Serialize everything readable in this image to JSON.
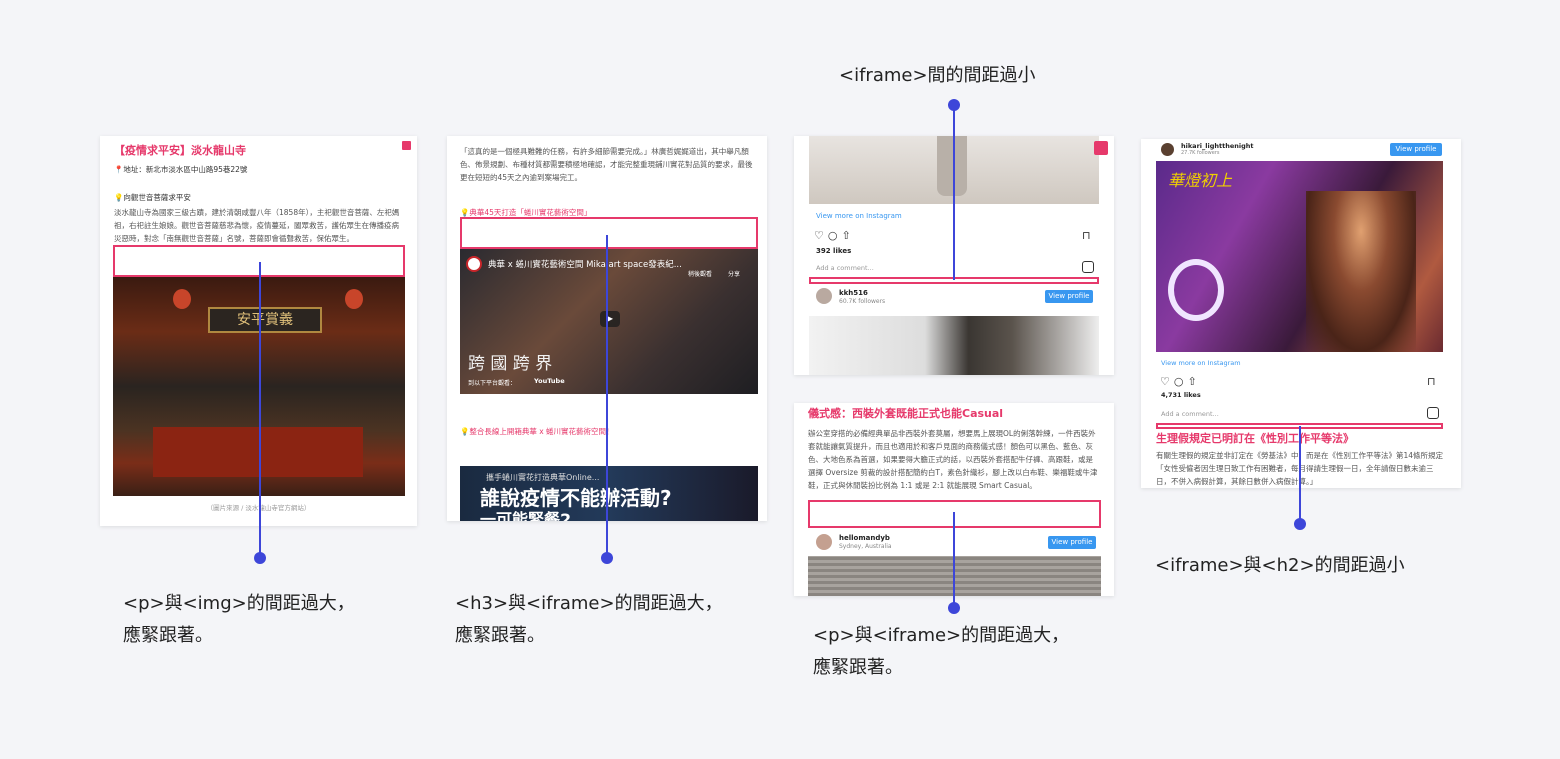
{
  "captions": {
    "c1": "<p>與<img>的間距過大，\n應緊跟著。",
    "c2": "<h3>與<iframe>的間距過大，\n應緊跟著。",
    "c3_top": "<iframe>間的間距過小",
    "c3_bottom": "<p>與<iframe>的間距過大，\n應緊跟著。",
    "c4": "<iframe>與<h2>的間距過小"
  },
  "card1": {
    "title": "【疫情求平安】淡水龍山寺",
    "address": "📍地址：新北市淡水區中山路95巷22號",
    "bullet": "💡向觀世音菩薩求平安",
    "para": "淡水龍山寺為國家三級古蹟，建於清朝咸豐八年（1858年），主祀觀世音菩薩、左祀媽祖，右祀註生娘娘。觀世音菩薩慈悲為懷，疫情蔓延，闔眾救苦，護佑眾生在傳播疫病災惡時，對念「南無觀世音菩薩」名號，菩薩即會循聲救苦，保佑眾生。",
    "plaque": "安平賞義",
    "credit": "（圖片來源 / 淡水龍山寺官方網站）"
  },
  "card2": {
    "quote": "「這真的是一個極具難難的任務，有許多細節需要完成。」林廣哲娓娓道出，其中舉凡顏色、佈景規劃、布種材質都需要積極地確認，才能完整重現鋪川實花對品質的要求，最後更在短短的45天之內逾到案場完工。",
    "h3a": "💡典華45天打造「蜷川實花藝術空間」",
    "video_title": "典華 x 蜷川實花藝術空間 Mika art space發表紀...",
    "watch_later": "稍後觀看",
    "share": "分享",
    "overlay_text": "跨 國 跨 界",
    "watch_on": "到以下平台觀看：",
    "youtube": "YouTube",
    "h3b": "💡整合長線上開箱典華 x 蜷川實花藝術空間！",
    "video2_small": "攜手蜷川實花打造典華Online...",
    "video2_title": "誰說疫情不能辦活動?",
    "video2_sub": "一可能緊餐2"
  },
  "card3": {
    "view_more": "View more on Instagram",
    "likes": "392 likes",
    "add_comment": "Add a comment...",
    "username": "kkh516",
    "followers": "60.7K followers",
    "view_profile": "View profile"
  },
  "card3b": {
    "heading": "儀式感：西裝外套既能正式也能Casual",
    "para": "辦公室穿搭的必備經典單品非西裝外套莫屬，想要馬上展現OL的俐落幹練，一件西裝外套就能讓氣質提升，而且也適用於和客戶見面的商務儀式感！顏色可以黑色、藍色、灰色、大地色系為首選，如果要得大膽正式的話，以西裝外套搭配牛仔褲、高跟鞋，或是選擇 Oversize 剪裁的設計搭配簡約白T，素色針織衫，腳上改以白布鞋、樂福鞋或牛津鞋，正式與休閒裝扮比例為 1:1 或是 2:1 就能展現 Smart Casual。",
    "username": "hellomandyb",
    "location": "Sydney, Australia",
    "view_profile": "View profile"
  },
  "card4": {
    "username": "hikari_lightthenight",
    "followers": "27.7K followers",
    "view_profile": "View profile",
    "poster_text": "華燈初上",
    "view_more": "View more on Instagram",
    "likes": "4,731 likes",
    "add_comment": "Add a comment...",
    "h2": "生理假規定已明訂在《性別工作平等法》",
    "para": "有關生理假的規定並非訂定在《勞基法》中，而是在《性別工作平等法》第14條所規定「女性受僱者因生理日致工作有困難者，每月得請生理假一日，全年請假日數未逾三日，不併入病假計算，其餘日數併入病假計算。」"
  }
}
